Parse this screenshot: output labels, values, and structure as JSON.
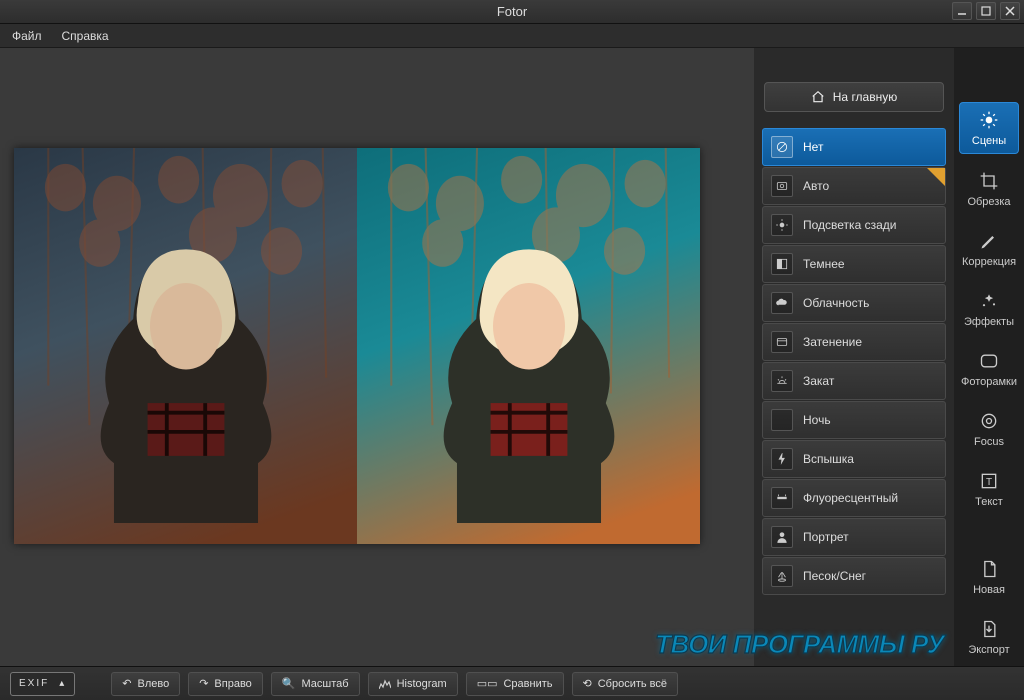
{
  "window": {
    "title": "Fotor"
  },
  "menubar": {
    "file": "Файл",
    "help": "Справка"
  },
  "home_button": "На главную",
  "scene_list": {
    "selected_index": 0,
    "items": [
      {
        "label": "Нет",
        "icon": "none"
      },
      {
        "label": "Авто",
        "icon": "auto",
        "star": true
      },
      {
        "label": "Подсветка сзади",
        "icon": "backlight"
      },
      {
        "label": "Темнее",
        "icon": "darken"
      },
      {
        "label": "Облачность",
        "icon": "cloudy"
      },
      {
        "label": "Затенение",
        "icon": "shade"
      },
      {
        "label": "Закат",
        "icon": "sunset"
      },
      {
        "label": "Ночь",
        "icon": "night"
      },
      {
        "label": "Вспышка",
        "icon": "flash"
      },
      {
        "label": "Флуоресцентный",
        "icon": "fluorescent"
      },
      {
        "label": "Портрет",
        "icon": "portrait"
      },
      {
        "label": "Песок/Снег",
        "icon": "sandsnow"
      }
    ]
  },
  "tools": {
    "selected_index": 0,
    "items": [
      {
        "label": "Сцены",
        "icon": "sun"
      },
      {
        "label": "Обрезка",
        "icon": "crop"
      },
      {
        "label": "Коррекция",
        "icon": "pencil"
      },
      {
        "label": "Эффекты",
        "icon": "sparkles"
      },
      {
        "label": "Фоторамки",
        "icon": "frame"
      },
      {
        "label": "Focus",
        "icon": "target"
      },
      {
        "label": "Текст",
        "icon": "text"
      },
      {
        "label": "Новая",
        "icon": "new"
      },
      {
        "label": "Экспорт",
        "icon": "export"
      }
    ]
  },
  "statusbar": {
    "exif": "EXIF",
    "rotate_left": "Влево",
    "rotate_right": "Вправо",
    "zoom": "Масштаб",
    "histogram": "Histogram",
    "compare": "Сравнить",
    "reset": "Сбросить всё"
  },
  "watermark_text": "ТВОИ ПРОГРАММЫ РУ"
}
